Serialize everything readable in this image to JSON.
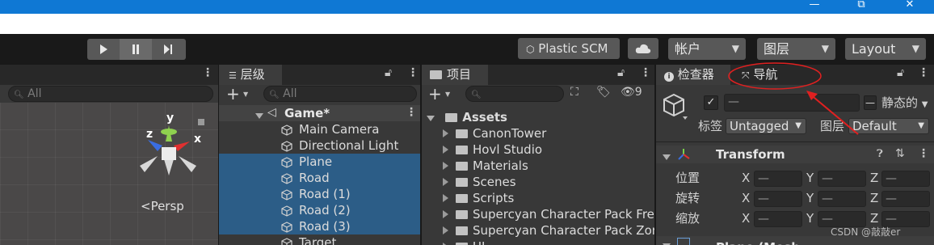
{
  "window": {
    "minimize": "—",
    "restore": "⧉",
    "close": "✕"
  },
  "toolbar": {
    "play_icon": "play-icon",
    "pause_icon": "pause-icon",
    "step_icon": "step-icon",
    "plastic_label": "Plastic SCM",
    "account_label": "帐户",
    "layers_label": "图层",
    "layout_label": "Layout"
  },
  "scene": {
    "search_placeholder": "All",
    "gizmo": {
      "x": "x",
      "y": "y",
      "z": "z"
    },
    "persp_label": "<Persp"
  },
  "hierarchy": {
    "tab_label": "层级",
    "add_label": "+",
    "search_placeholder": "All",
    "scene_name": "Game*",
    "items": [
      {
        "label": "Main Camera",
        "selected": false
      },
      {
        "label": "Directional Light",
        "selected": false
      },
      {
        "label": "Plane",
        "selected": true
      },
      {
        "label": "Road",
        "selected": true
      },
      {
        "label": "Road (1)",
        "selected": true
      },
      {
        "label": "Road (2)",
        "selected": true
      },
      {
        "label": "Road (3)",
        "selected": true
      },
      {
        "label": "Target",
        "selected": false
      }
    ]
  },
  "project": {
    "tab_label": "项目",
    "add_label": "+",
    "hidden_count": "9",
    "root": "Assets",
    "folders": [
      "CanonTower",
      "Hovl Studio",
      "Materials",
      "Scenes",
      "Scripts",
      "Supercyan Character Pack Free",
      "Supercyan Character Pack Zom",
      "UI"
    ]
  },
  "inspector": {
    "tab_label": "检查器",
    "nav_tab_label": "导航",
    "name_value": "—",
    "static_label": "静态的",
    "tag_label": "标签",
    "tag_value": "Untagged",
    "layer_label": "图层",
    "layer_value": "Default",
    "transform_title": "Transform",
    "rows": [
      {
        "label": "位置",
        "x": "—",
        "y": "—",
        "z": "—"
      },
      {
        "label": "旋转",
        "x": "—",
        "y": "—",
        "z": "—"
      },
      {
        "label": "缩放",
        "x": "—",
        "y": "—",
        "z": "—"
      }
    ],
    "axis_x": "X",
    "axis_y": "Y",
    "axis_z": "Z",
    "next_component": "Plane (Mesh Filter)"
  },
  "watermark": "CSDN @敲敲er",
  "colors": {
    "title_blue": "#0f78d4",
    "selection": "#2c5d87",
    "annotation_red": "#e02020"
  }
}
